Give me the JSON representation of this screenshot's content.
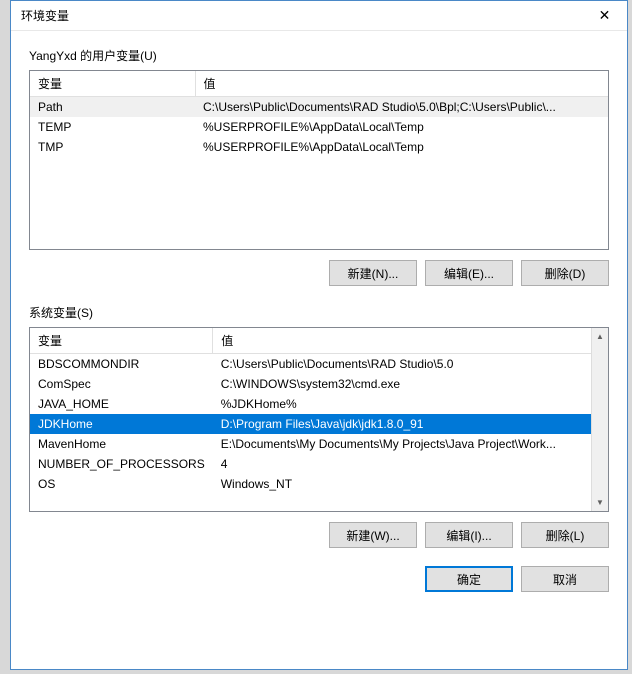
{
  "window": {
    "title": "环境变量"
  },
  "user_section": {
    "label": "YangYxd 的用户变量(U)",
    "columns": {
      "variable": "变量",
      "value": "值"
    },
    "rows": [
      {
        "variable": "Path",
        "value": "C:\\Users\\Public\\Documents\\RAD Studio\\5.0\\Bpl;C:\\Users\\Public\\..."
      },
      {
        "variable": "TEMP",
        "value": "%USERPROFILE%\\AppData\\Local\\Temp"
      },
      {
        "variable": "TMP",
        "value": "%USERPROFILE%\\AppData\\Local\\Temp"
      }
    ],
    "buttons": {
      "new": "新建(N)...",
      "edit": "编辑(E)...",
      "delete": "删除(D)"
    }
  },
  "system_section": {
    "label": "系统变量(S)",
    "columns": {
      "variable": "变量",
      "value": "值"
    },
    "rows": [
      {
        "variable": "BDSCOMMONDIR",
        "value": "C:\\Users\\Public\\Documents\\RAD Studio\\5.0"
      },
      {
        "variable": "ComSpec",
        "value": "C:\\WINDOWS\\system32\\cmd.exe"
      },
      {
        "variable": "JAVA_HOME",
        "value": "%JDKHome%"
      },
      {
        "variable": "JDKHome",
        "value": "D:\\Program Files\\Java\\jdk\\jdk1.8.0_91"
      },
      {
        "variable": "MavenHome",
        "value": "E:\\Documents\\My Documents\\My Projects\\Java Project\\Work..."
      },
      {
        "variable": "NUMBER_OF_PROCESSORS",
        "value": "4"
      },
      {
        "variable": "OS",
        "value": "Windows_NT"
      }
    ],
    "buttons": {
      "new": "新建(W)...",
      "edit": "编辑(I)...",
      "delete": "删除(L)"
    }
  },
  "dialog_buttons": {
    "ok": "确定",
    "cancel": "取消"
  }
}
